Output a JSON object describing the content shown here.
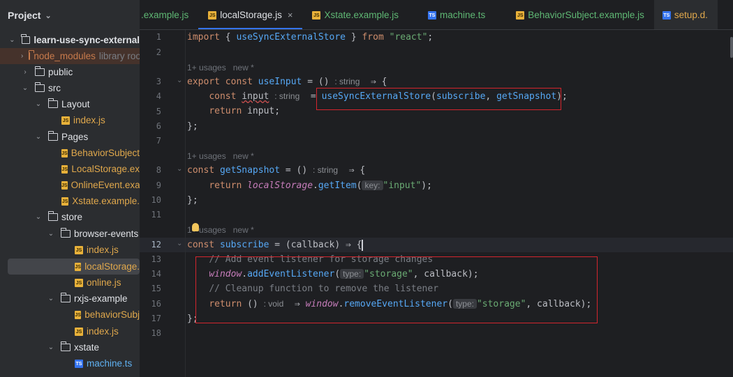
{
  "sidebar": {
    "title": "Project",
    "tree": [
      {
        "label": "learn-use-sync-external",
        "kind": "folder"
      },
      {
        "label": "node_modules",
        "kind": "folder",
        "suffix": "library root"
      },
      {
        "label": "public",
        "kind": "folder"
      },
      {
        "label": "src",
        "kind": "folder"
      },
      {
        "label": "Layout",
        "kind": "folder"
      },
      {
        "label": "index.js",
        "kind": "js"
      },
      {
        "label": "Pages",
        "kind": "folder"
      },
      {
        "label": "BehaviorSubject",
        "kind": "js"
      },
      {
        "label": "LocalStorage.ex",
        "kind": "js"
      },
      {
        "label": "OnlineEvent.exa",
        "kind": "js"
      },
      {
        "label": "Xstate.example.",
        "kind": "js"
      },
      {
        "label": "store",
        "kind": "folder"
      },
      {
        "label": "browser-events",
        "kind": "folder"
      },
      {
        "label": "index.js",
        "kind": "js"
      },
      {
        "label": "localStorage.",
        "kind": "js"
      },
      {
        "label": "online.js",
        "kind": "js"
      },
      {
        "label": "rxjs-example",
        "kind": "folder"
      },
      {
        "label": "behaviorSubj",
        "kind": "js"
      },
      {
        "label": "index.js",
        "kind": "js"
      },
      {
        "label": "xstate",
        "kind": "folder"
      },
      {
        "label": "machine.ts",
        "kind": "ts"
      }
    ]
  },
  "tabs": [
    {
      "label": ".example.js",
      "icon": "js-icon"
    },
    {
      "label": "localStorage.js",
      "icon": "js-icon",
      "active": true
    },
    {
      "label": "Xstate.example.js",
      "icon": "js-icon"
    },
    {
      "label": "machine.ts",
      "icon": "ts-icon"
    },
    {
      "label": "BehaviorSubject.example.js",
      "icon": "js-icon"
    },
    {
      "label": "setup.d.",
      "icon": "ts-icon"
    }
  ],
  "editor": {
    "line_numbers": [
      "1",
      "2",
      "3",
      "4",
      "5",
      "6",
      "7",
      "8",
      "9",
      "10",
      "11",
      "12",
      "13",
      "14",
      "15",
      "16",
      "17",
      "18"
    ],
    "hints": {
      "usages": "1+ usages",
      "new": "new *"
    },
    "code": {
      "import_kw": "import",
      "import_brace_open": " { ",
      "import_name": "useSyncExternalStore",
      "import_brace_close": " } ",
      "from_kw": "from",
      "react_str": "\"react\"",
      "semi": ";",
      "export_kw": "export",
      "const_kw": "const",
      "useInput": "useInput",
      "eq_paren": " = () ",
      "type_string": ": string",
      "arrow": "  ⇒ {",
      "input_var": "input",
      "eq": " = ",
      "useSync": "useSyncExternalStore",
      "args_open": "(",
      "subscribe": "subscribe",
      "comma": ", ",
      "getSnapshot": "getSnapshot",
      "args_close": ");",
      "return_kw": "return",
      "return_input": " input;",
      "close_brace": "};",
      "getSnapshot_decl": "getSnapshot",
      "localStorage": "localStorage",
      "getItem": "getItem",
      "key_hint": "key:",
      "input_str": "\"input\"",
      "paren_close_semi": ");",
      "subscribe_decl": "subscribe",
      "callback_arrow": " = (callback) ⇒ {",
      "comment1": "// Add event listener for storage changes",
      "window": "window",
      "addEventListener": "addEventListener",
      "type_hint": "type:",
      "storage_str": "\"storage\"",
      "callback_tail": ", callback);",
      "comment2": "// Cleanup function to remove the listener",
      "return_paren": " () ",
      "type_void": ": void",
      "arrow2": "  ⇒ ",
      "removeEventListener": "removeEventListener"
    }
  }
}
